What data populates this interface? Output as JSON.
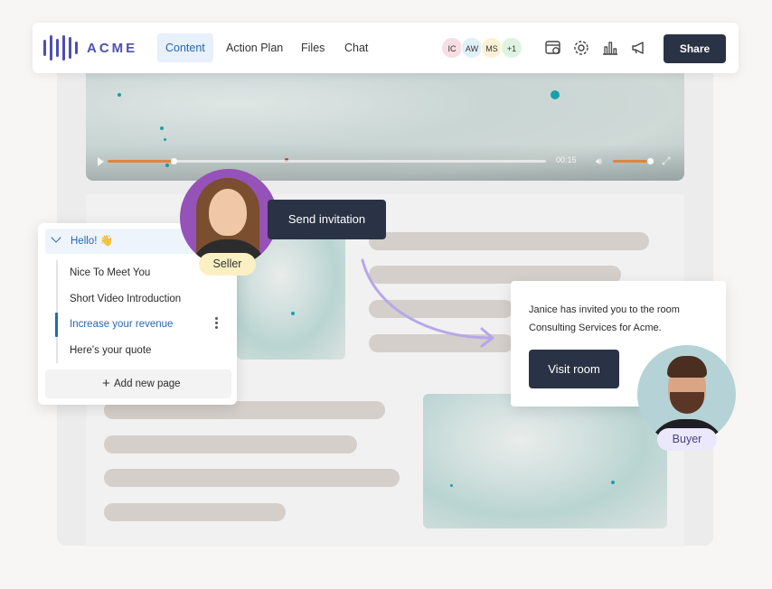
{
  "brand": {
    "name": "ACME"
  },
  "nav": {
    "tabs": [
      {
        "label": "Content",
        "active": true
      },
      {
        "label": "Action Plan",
        "active": false
      },
      {
        "label": "Files",
        "active": false
      },
      {
        "label": "Chat",
        "active": false
      }
    ],
    "participants": [
      {
        "initials": "IC",
        "color": "#f7dde4"
      },
      {
        "initials": "AW",
        "color": "#dff0f7"
      },
      {
        "initials": "MS",
        "color": "#fbf2d6"
      },
      {
        "initials": "+1",
        "color": "#dff3e2"
      }
    ],
    "icons": [
      "calendar-clock-icon",
      "gear-icon",
      "bar-chart-icon",
      "megaphone-icon"
    ],
    "share_label": "Share"
  },
  "video": {
    "time": "00:15",
    "progress": 0.15,
    "volume": 0.85,
    "accent": "#e2843c"
  },
  "sidebar": {
    "section_title": "Hello! 👋",
    "pages": [
      {
        "label": "Nice To Meet You",
        "active": false
      },
      {
        "label": "Short Video Introduction",
        "active": false
      },
      {
        "label": "Increase your revenue",
        "active": true
      },
      {
        "label": "Here's your quote",
        "active": false
      }
    ],
    "add_page_label": "Add new page"
  },
  "seller": {
    "tag": "Seller",
    "action_label": "Send invitation"
  },
  "invite": {
    "line1": "Janice has invited you to the room",
    "line2": "Consulting Services for Acme.",
    "button_label": "Visit room"
  },
  "buyer": {
    "tag": "Buyer"
  },
  "colors": {
    "primary_dark": "#2a3345",
    "accent_blue": "#2767b0",
    "brand": "#4f4fb0"
  }
}
